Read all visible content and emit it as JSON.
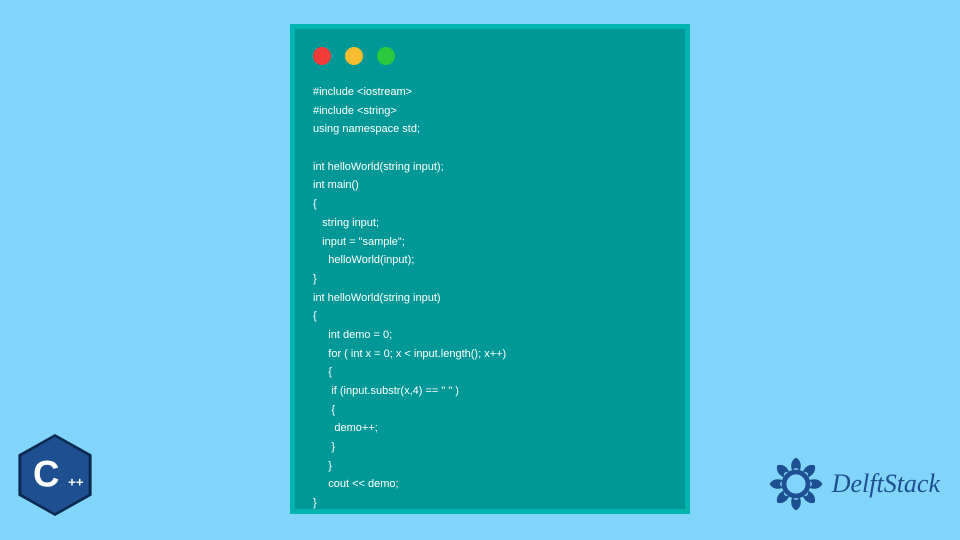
{
  "traffic_lights": {
    "red": "#f63c3b",
    "amber": "#f9bd2f",
    "green": "#2bc940"
  },
  "code_lines": [
    "#include <iostream>",
    "#include <string>",
    "using namespace std;",
    "",
    "int helloWorld(string input);",
    "int main()",
    "{",
    "   string input;",
    "   input = \"sample\";",
    "     helloWorld(input);",
    "}",
    "int helloWorld(string input)",
    "{",
    "     int demo = 0;",
    "     for ( int x = 0; x < input.length(); x++)",
    "     {",
    "      if (input.substr(x,4) == \" \" )",
    "      {",
    "       demo++;",
    "      }",
    "     }",
    "     cout << demo;",
    "}"
  ],
  "cpp_badge": {
    "label": "C",
    "plusplus": "++",
    "fill": "#1d4f91",
    "shadow": "#0a2a52"
  },
  "delft": {
    "text": "DelftStack",
    "logo_color": "#1d4f91"
  }
}
